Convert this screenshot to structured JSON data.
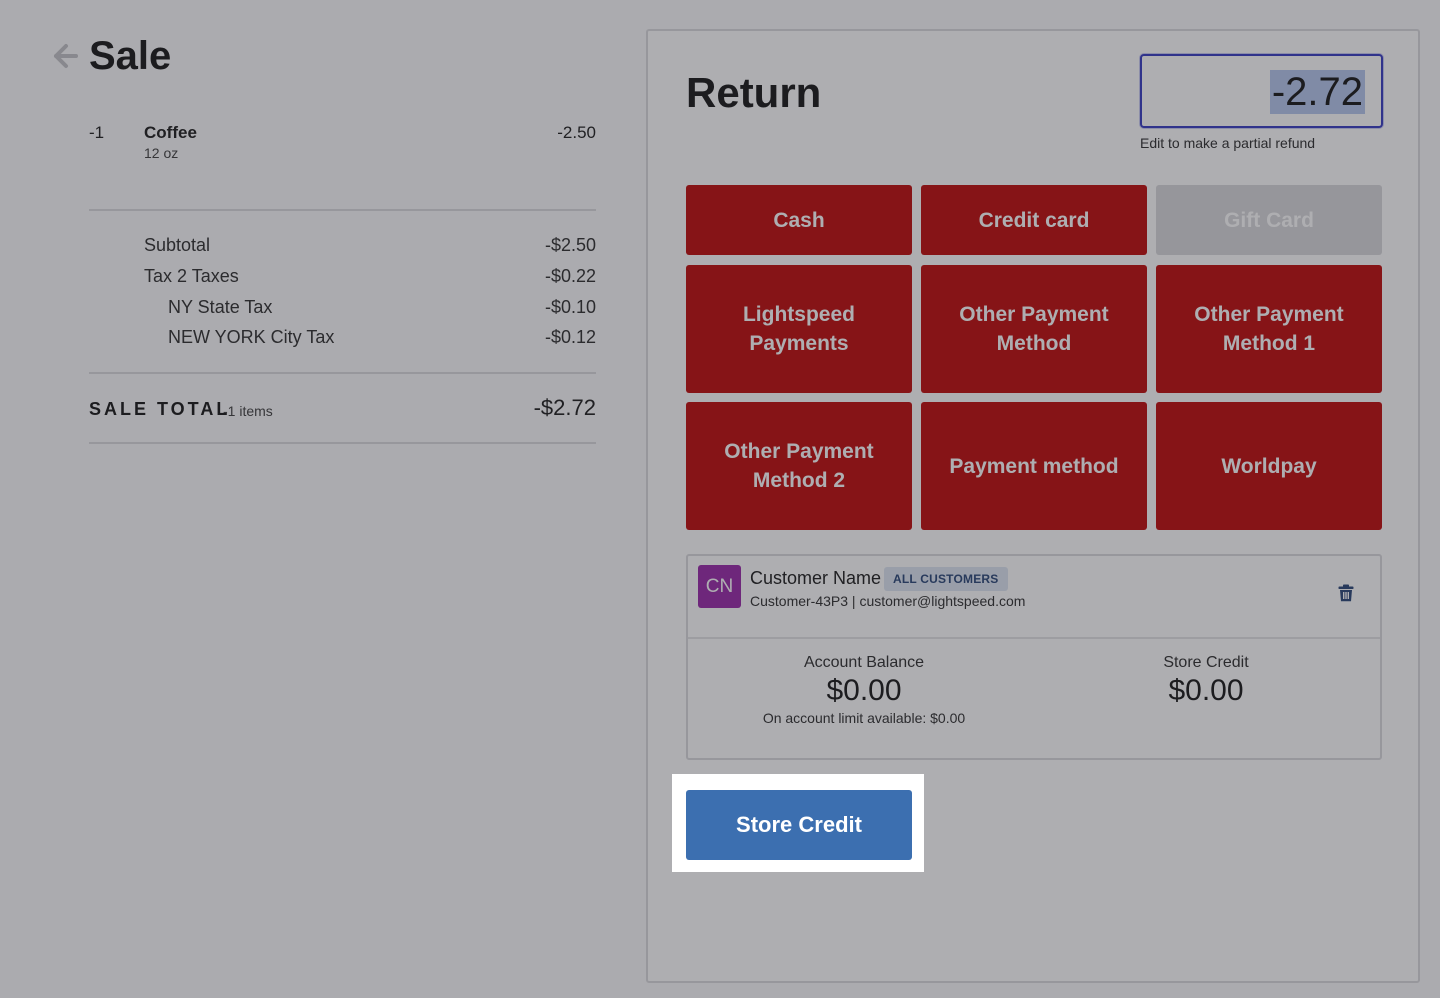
{
  "sale": {
    "title": "Sale",
    "line_items": [
      {
        "qty": "-1",
        "name": "Coffee",
        "variant": "12 oz",
        "price": "-2.50"
      }
    ],
    "subtotal_label": "Subtotal",
    "subtotal_value": "-$2.50",
    "tax_label": "Tax 2 Taxes",
    "tax_value": "-$0.22",
    "taxes": [
      {
        "label": "NY State Tax",
        "value": "-$0.10"
      },
      {
        "label": "NEW YORK City Tax",
        "value": "-$0.12"
      }
    ],
    "total_label": "SALE TOTAL",
    "total_items": "-1 items",
    "total_value": "-$2.72"
  },
  "return": {
    "title": "Return",
    "amount": "-2.72",
    "amount_hint": "Edit to make a partial refund",
    "payment_methods": [
      {
        "label": "Cash",
        "enabled": true
      },
      {
        "label": "Credit card",
        "enabled": true
      },
      {
        "label": "Gift Card",
        "enabled": false
      },
      {
        "label": "Lightspeed Payments",
        "enabled": true
      },
      {
        "label": "Other Payment Method",
        "enabled": true
      },
      {
        "label": "Other Payment Method 1",
        "enabled": true
      },
      {
        "label": "Other Payment Method 2",
        "enabled": true
      },
      {
        "label": "Payment method",
        "enabled": true
      },
      {
        "label": "Worldpay",
        "enabled": true
      }
    ],
    "colors": {
      "payment_button": "#c10f0f",
      "disabled_button": "#dadadd",
      "primary": "#3c6fb0",
      "focus": "#3a3fc4"
    }
  },
  "customer": {
    "initials": "CN",
    "name": "Customer Name",
    "group_badge": "ALL CUSTOMERS",
    "meta": "Customer-43P3 | customer@lightspeed.com",
    "account_balance_label": "Account Balance",
    "account_balance": "$0.00",
    "account_limit_note": "On account limit available: $0.00",
    "store_credit_label": "Store Credit",
    "store_credit": "$0.00",
    "avatar_color": "#9b2cab"
  },
  "actions": {
    "store_credit_button": "Store Credit"
  }
}
